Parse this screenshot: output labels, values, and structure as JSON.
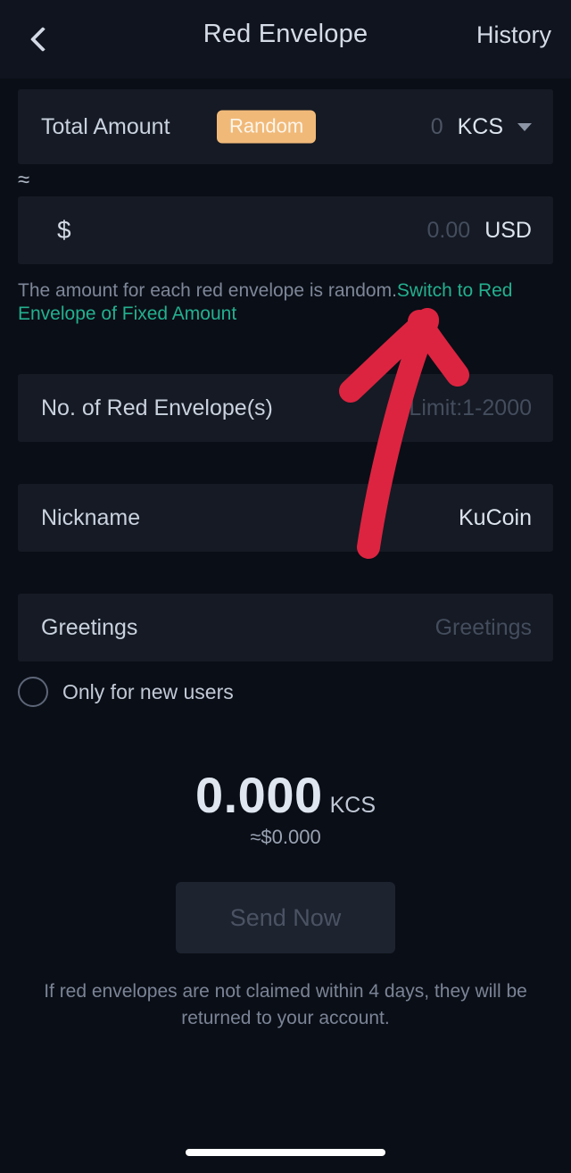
{
  "header": {
    "back_icon": "chevron-left-icon",
    "title": "Red Envelope",
    "action_label": "History"
  },
  "form": {
    "total_amount": {
      "label": "Total Amount",
      "badge": "Random",
      "value_placeholder": "0",
      "currency": "KCS",
      "currency_caret_icon": "chevron-down-icon"
    },
    "fiat": {
      "symbol": "$",
      "value_placeholder": "0.00",
      "currency": "USD",
      "approx_symbol": "≈"
    },
    "hint": {
      "text": "The amount for each red envelope is random.",
      "link": "Switch to Red Envelope of Fixed Amount"
    },
    "count": {
      "label": "No. of Red Envelope(s)",
      "placeholder": "Limit:1-2000"
    },
    "nickname": {
      "label": "Nickname",
      "value": "KuCoin"
    },
    "greetings": {
      "label": "Greetings",
      "placeholder": "Greetings"
    },
    "new_users_only": {
      "label": "Only for new users",
      "checked": false
    }
  },
  "summary": {
    "amount": "0.000",
    "unit": "KCS",
    "fiat_equiv": "≈$0.000"
  },
  "send_button": {
    "label": "Send Now",
    "disabled": true
  },
  "footer_note": "If red envelopes are not claimed within 4 days, they will be returned to your account.",
  "annotation": {
    "type": "arrow",
    "color": "#dc2440",
    "points_to": "Switch to Red Envelope of Fixed Amount"
  },
  "colors": {
    "page_bg": "#0a0e16",
    "card_bg": "#151a24",
    "header_bg": "#10141e",
    "accent_green": "#23b08f",
    "badge_orange": "#f1b978",
    "annotation_red": "#dc2440"
  }
}
